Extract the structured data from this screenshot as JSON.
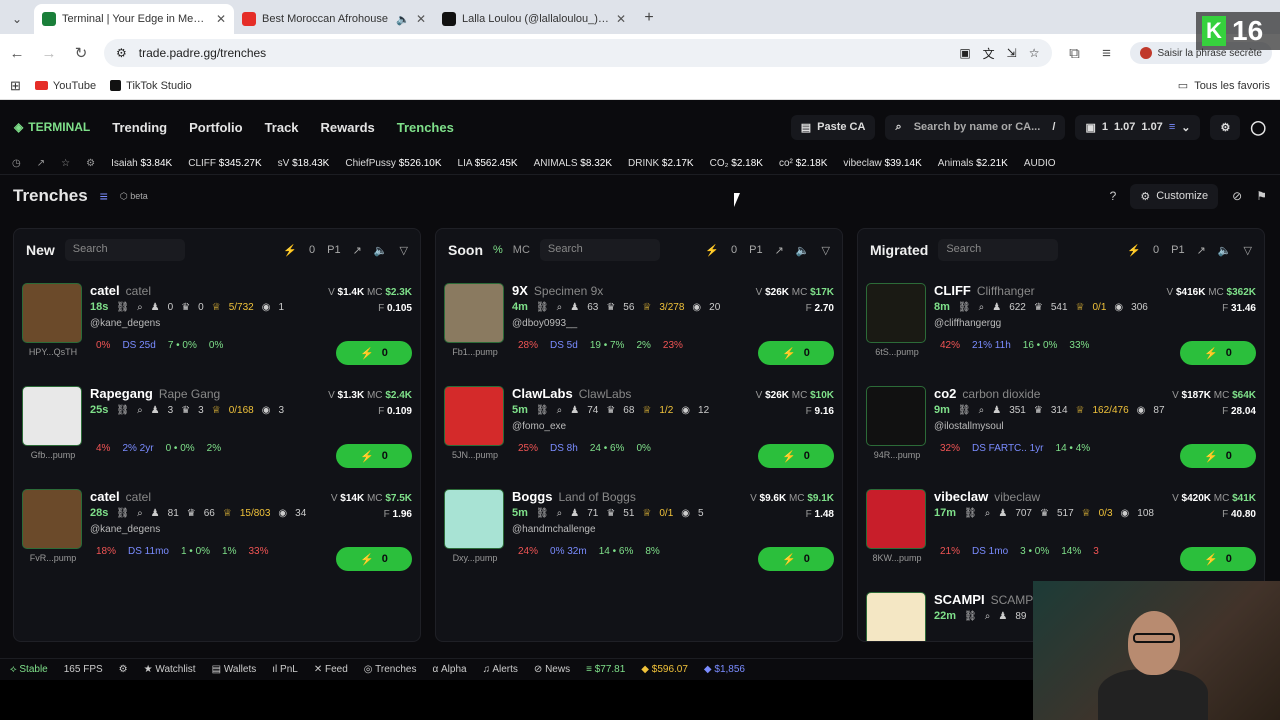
{
  "browser": {
    "tabs": [
      {
        "title": "Terminal | Your Edge in Memec",
        "fav_color": "#1a7f3a",
        "active": true
      },
      {
        "title": "Best Moroccan Afrohouse",
        "fav_color": "#e52d27",
        "active": false
      },
      {
        "title": "Lalla Loulou (@lallaloulou_) est",
        "fav_color": "#111111",
        "active": false
      }
    ],
    "url": "trade.padre.gg/trenches",
    "secret_pill": "Saisir la phrase secrète",
    "bookmarks": [
      "YouTube",
      "TikTok Studio"
    ],
    "all_favorites": "Tous les favoris"
  },
  "nav": {
    "logo": "TERMINAL",
    "links": [
      "Trending",
      "Portfolio",
      "Track",
      "Rewards",
      "Trenches"
    ],
    "active": "Trenches",
    "paste_ca": "Paste CA",
    "search_placeholder": "Search by name or CA...",
    "search_shortcut": "/",
    "wallet_count": "1",
    "bal1": "1.07",
    "bal2": "1.07"
  },
  "ticker": [
    {
      "name": "Isaiah",
      "value": "$3.84K"
    },
    {
      "name": "CLIFF",
      "value": "$345.27K"
    },
    {
      "name": "sV",
      "value": "$18.43K"
    },
    {
      "name": "ChiefPussy",
      "value": "$526.10K"
    },
    {
      "name": "LIA",
      "value": "$562.45K"
    },
    {
      "name": "ANIMALS",
      "value": "$8.32K"
    },
    {
      "name": "DRINK",
      "value": "$2.17K"
    },
    {
      "name": "CO₂",
      "value": "$2.18K"
    },
    {
      "name": "co²",
      "value": "$2.18K"
    },
    {
      "name": "vibeclaw",
      "value": "$39.14K"
    },
    {
      "name": "Animals",
      "value": "$2.21K"
    },
    {
      "name": "AUDIO",
      "value": ""
    }
  ],
  "page": {
    "title": "Trenches",
    "beta": "beta",
    "customize": "Customize"
  },
  "columns": [
    {
      "title": "New",
      "search": "Search",
      "count": "0",
      "preset": "P1",
      "cards": [
        {
          "name": "catel",
          "sub": "catel",
          "age": "18s",
          "holders": "0",
          "h2": "0",
          "gold": "5/732",
          "views": "1",
          "handle": "@kane_degens",
          "lab": "HPY...QsTH",
          "v": "$1.4K",
          "mc": "$2.3K",
          "f": "0.105",
          "s1": "0%",
          "s2": "DS 25d",
          "s3": "7 • 0%",
          "s4": "0%",
          "av": "#6b4a2a"
        },
        {
          "name": "Rapegang",
          "sub": "Rape Gang",
          "age": "25s",
          "holders": "3",
          "h2": "3",
          "gold": "0/168",
          "views": "3",
          "handle": "",
          "lab": "Gfb...pump",
          "v": "$1.3K",
          "mc": "$2.4K",
          "f": "0.109",
          "s1": "4%",
          "s2": "2% 2yr",
          "s3": "0 • 0%",
          "s4": "2%",
          "av": "#e8e8e8"
        },
        {
          "name": "catel",
          "sub": "catel",
          "age": "28s",
          "holders": "81",
          "h2": "66",
          "gold": "15/803",
          "views": "34",
          "handle": "@kane_degens",
          "lab": "FvR...pump",
          "v": "$14K",
          "mc": "$7.5K",
          "f": "1.96",
          "s1": "18%",
          "s2": "DS 11mo",
          "s3": "1 • 0%",
          "s4": "1%",
          "s5": "33%",
          "av": "#6b4a2a"
        }
      ]
    },
    {
      "title": "Soon",
      "search": "Search",
      "count": "0",
      "preset": "P1",
      "pct": "%",
      "mcl": "MC",
      "cards": [
        {
          "name": "9X",
          "sub": "Specimen 9x",
          "age": "4m",
          "holders": "63",
          "h2": "56",
          "gold": "3/278",
          "views": "20",
          "handle": "@dboy0993__",
          "lab": "Fb1...pump",
          "v": "$26K",
          "mc": "$17K",
          "f": "2.70",
          "s1": "28%",
          "s2": "DS 5d",
          "s3": "19 • 7%",
          "s4": "2%",
          "s5": "23%",
          "av": "#8a7a60"
        },
        {
          "name": "ClawLabs",
          "sub": "ClawLabs",
          "age": "5m",
          "holders": "74",
          "h2": "68",
          "gold": "1/2",
          "views": "12",
          "handle": "@fomo_exe",
          "lab": "5JN...pump",
          "v": "$26K",
          "mc": "$10K",
          "f": "9.16",
          "s1": "25%",
          "s2": "DS 8h",
          "s3": "24 • 6%",
          "s4": "0%",
          "av": "#d42a2a"
        },
        {
          "name": "Boggs",
          "sub": "Land of Boggs",
          "age": "5m",
          "holders": "71",
          "h2": "51",
          "gold": "0/1",
          "views": "5",
          "handle": "@handmchallenge",
          "lab": "Dxy...pump",
          "v": "$9.6K",
          "mc": "$9.1K",
          "f": "1.48",
          "s1": "24%",
          "s2": "0% 32m",
          "s3": "14 • 6%",
          "s4": "8%",
          "av": "#a8e3d4"
        }
      ]
    },
    {
      "title": "Migrated",
      "search": "Search",
      "count": "0",
      "preset": "P1",
      "cards": [
        {
          "name": "CLIFF",
          "sub": "Cliffhanger",
          "age": "8m",
          "holders": "622",
          "h2": "541",
          "gold": "0/1",
          "views": "306",
          "handle": "@cliffhangergg",
          "lab": "6tS...pump",
          "v": "$416K",
          "mc": "$362K",
          "f": "31.46",
          "s1": "42%",
          "s2": "21% 11h",
          "s3": "16 • 0%",
          "s4": "33%",
          "av": "#1a1a14"
        },
        {
          "name": "co2",
          "sub": "carbon dioxide",
          "age": "9m",
          "holders": "351",
          "h2": "314",
          "gold": "162/476",
          "views": "87",
          "handle": "@ilostallmysoul",
          "lab": "94R...pump",
          "v": "$187K",
          "mc": "$64K",
          "f": "28.04",
          "s1": "32%",
          "s2": "DS FARTC.. 1yr",
          "s3": "14 • 4%",
          "s4": "",
          "av": "#111111"
        },
        {
          "name": "vibeclaw",
          "sub": "vibeclaw",
          "age": "17m",
          "holders": "707",
          "h2": "517",
          "gold": "0/3",
          "views": "108",
          "handle": "",
          "lab": "8KW...pump",
          "v": "$420K",
          "mc": "$41K",
          "f": "40.80",
          "s1": "21%",
          "s2": "DS 1mo",
          "s3": "3 • 0%",
          "s4": "14%",
          "s5": "3",
          "av": "#c81e2a"
        },
        {
          "name": "SCAMPI",
          "sub": "SCAMPI",
          "age": "22m",
          "holders": "89",
          "av": "#f4e7c4"
        }
      ]
    }
  ],
  "buy_label": "0",
  "footer": {
    "stable": "Stable",
    "fps": "165 FPS",
    "items": [
      "Watchlist",
      "Wallets",
      "PnL",
      "Feed",
      "Trenches",
      "Alpha",
      "Alerts",
      "News"
    ],
    "sol": "$77.81",
    "bnb": "$596.07",
    "eth": "$1,856"
  },
  "overlay_badge": "16"
}
